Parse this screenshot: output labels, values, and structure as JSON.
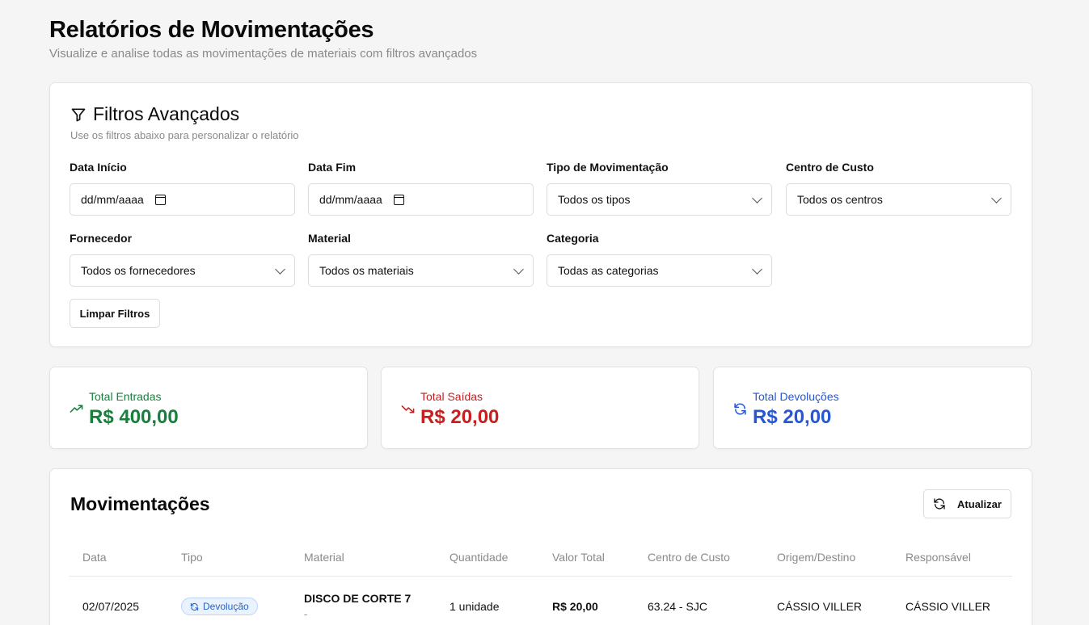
{
  "header": {
    "title": "Relatórios de Movimentações",
    "subtitle": "Visualize e analise todas as movimentações de materiais com filtros avançados"
  },
  "filters": {
    "title": "Filtros Avançados",
    "subtitle": "Use os filtros abaixo para personalizar o relatório",
    "icon": "filter-icon",
    "date_start": {
      "label": "Data Início",
      "value": "dd/mm/aaaa"
    },
    "date_end": {
      "label": "Data Fim",
      "value": "dd/mm/aaaa"
    },
    "movement_type": {
      "label": "Tipo de Movimentação",
      "value": "Todos os tipos"
    },
    "cost_center": {
      "label": "Centro de Custo",
      "value": "Todos os centros"
    },
    "supplier": {
      "label": "Fornecedor",
      "value": "Todos os fornecedores"
    },
    "material": {
      "label": "Material",
      "value": "Todos os materiais"
    },
    "category": {
      "label": "Categoria",
      "value": "Todas as categorias"
    },
    "clear_label": "Limpar Filtros"
  },
  "stats": {
    "entries": {
      "label": "Total Entradas",
      "value": "R$ 400,00",
      "color": "#16803c",
      "icon": "trending-up-icon"
    },
    "exits": {
      "label": "Total Saídas",
      "value": "R$ 20,00",
      "color": "#c81e1e",
      "icon": "trending-down-icon"
    },
    "returns": {
      "label": "Total Devoluções",
      "value": "R$ 20,00",
      "color": "#2557d6",
      "icon": "refresh-icon"
    }
  },
  "movements": {
    "title": "Movimentações",
    "refresh_label": "Atualizar",
    "columns": [
      "Data",
      "Tipo",
      "Material",
      "Quantidade",
      "Valor Total",
      "Centro de Custo",
      "Origem/Destino",
      "Responsável"
    ],
    "rows": [
      {
        "date": "02/07/2025",
        "type": "Devolução",
        "material": "DISCO DE CORTE 7",
        "material_sub": "-",
        "quantity": "1 unidade",
        "total": "R$ 20,00",
        "cost_center": "63.24 - SJC",
        "origin": "CÁSSIO VILLER",
        "responsible": "CÁSSIO VILLER"
      }
    ]
  }
}
